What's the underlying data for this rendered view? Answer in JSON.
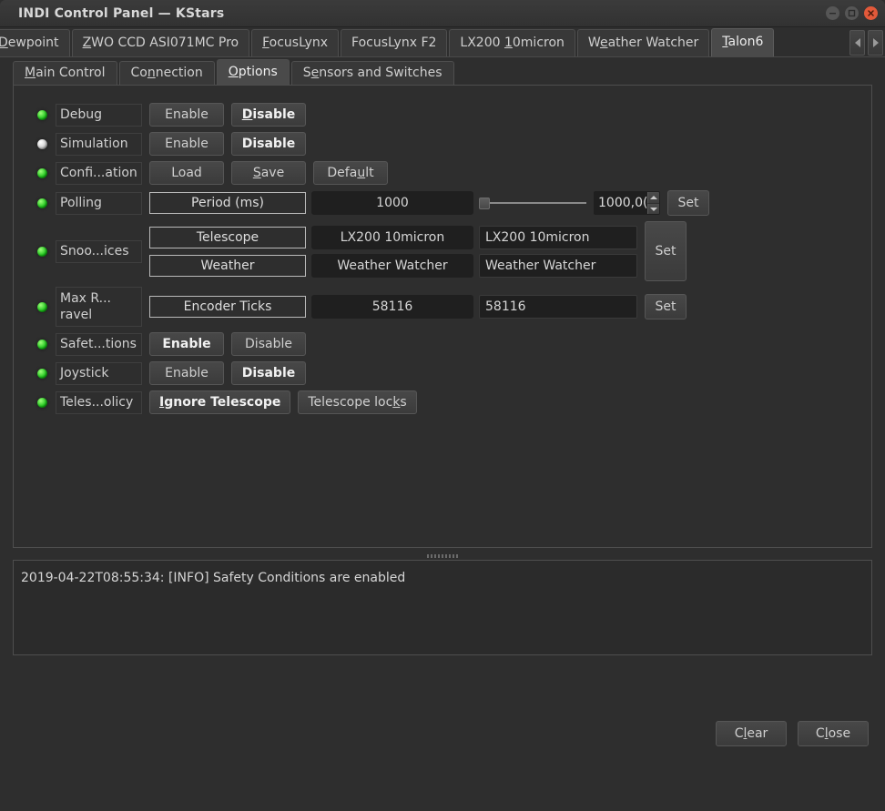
{
  "window": {
    "title": "INDI Control Panel — KStars",
    "controls": [
      {
        "name": "minimize",
        "glyph": "–"
      },
      {
        "name": "maximize",
        "glyph": "□"
      },
      {
        "name": "close",
        "glyph": "×"
      }
    ]
  },
  "device_tabs": [
    {
      "label": "Dewpoint",
      "prefix": "\u0003",
      "acc": "D",
      "active": false,
      "clipped": true
    },
    {
      "label": "ZWO CCD ASI071MC Pro",
      "acc": "Z",
      "active": false
    },
    {
      "label": "FocusLynx",
      "acc": "F",
      "active": false
    },
    {
      "label": "FocusLynx F2",
      "acc": "",
      "active": false
    },
    {
      "label": "LX200 10micron",
      "acc": "1",
      "active": false
    },
    {
      "label": "Weather Watcher",
      "acc": "W",
      "active": false
    },
    {
      "label": "Talon6",
      "acc": "T",
      "active": true
    }
  ],
  "tab_scroll": {
    "left": "scroll-left",
    "right": "scroll-right"
  },
  "sub_tabs": [
    {
      "label": "Main Control",
      "acc": "M",
      "active": false
    },
    {
      "label": "Connection",
      "acc": "n",
      "active": false
    },
    {
      "label": "Options",
      "acc": "O",
      "active": true
    },
    {
      "label": "Sensors and Switches",
      "acc": "e",
      "active": false
    }
  ],
  "properties": [
    {
      "name": "debug",
      "label": "Debug",
      "led": "ok",
      "type": "switch",
      "buttons": [
        {
          "label": "Enable",
          "state": "off",
          "acc": ""
        },
        {
          "label": "Disable",
          "state": "on",
          "acc": "D"
        }
      ]
    },
    {
      "name": "simulation",
      "label": "Simulation",
      "led": "idle",
      "type": "switch",
      "buttons": [
        {
          "label": "Enable",
          "state": "off",
          "acc": ""
        },
        {
          "label": "Disable",
          "state": "on",
          "acc": ""
        }
      ]
    },
    {
      "name": "configuration",
      "label": "Confi...ation",
      "led": "ok",
      "type": "switch",
      "buttons": [
        {
          "label": "Load",
          "state": "off",
          "acc": ""
        },
        {
          "label": "Save",
          "state": "off",
          "acc": "S"
        },
        {
          "label": "Default",
          "state": "off",
          "acc": "u"
        }
      ]
    },
    {
      "name": "polling",
      "label": "Polling",
      "led": "ok",
      "type": "number-slider",
      "field_name": "Period (ms)",
      "value": "1000",
      "spin_value": "1000,0(",
      "slider_position": 0,
      "set_label": "Set"
    },
    {
      "name": "snoop-devices",
      "label": "Snoo...ices",
      "led": "ok",
      "type": "text-rows",
      "set_label": "Set",
      "rows": [
        {
          "field_name": "Telescope",
          "value": "LX200 10micron",
          "input": "LX200 10micron"
        },
        {
          "field_name": "Weather",
          "value": "Weather Watcher",
          "input": "Weather Watcher"
        }
      ]
    },
    {
      "name": "max-ravel-travel",
      "label_line1": "Max R...",
      "label_line2": "ravel",
      "led": "ok",
      "type": "number-rows",
      "set_label": "Set",
      "rows": [
        {
          "field_name": "Encoder Ticks",
          "value": "58116",
          "input": "58116"
        }
      ]
    },
    {
      "name": "safety-conditions",
      "label": "Safet...tions",
      "led": "ok",
      "type": "switch",
      "buttons": [
        {
          "label": "Enable",
          "state": "on",
          "acc": ""
        },
        {
          "label": "Disable",
          "state": "off",
          "acc": ""
        }
      ]
    },
    {
      "name": "joystick",
      "label": "Joystick",
      "led": "ok",
      "type": "switch",
      "buttons": [
        {
          "label": "Enable",
          "state": "off",
          "acc": ""
        },
        {
          "label": "Disable",
          "state": "on",
          "acc": ""
        }
      ]
    },
    {
      "name": "telescope-policy",
      "label": "Teles...olicy",
      "led": "ok",
      "type": "switch",
      "buttons": [
        {
          "label": "Ignore Telescope",
          "state": "on",
          "acc": "I"
        },
        {
          "label": "Telescope locks",
          "state": "off",
          "acc": "k"
        }
      ]
    }
  ],
  "log": {
    "lines": [
      "2019-04-22T08:55:34: [INFO] Safety Conditions are enabled"
    ]
  },
  "footer": {
    "clear_label": "Clear",
    "clear_acc": "l",
    "close_label": "Close",
    "close_acc": "l"
  },
  "colors": {
    "window_bg": "#2e2e2e",
    "titlebar": "#383838",
    "close_button": "#e2593a",
    "led_ok": "#17c117",
    "led_idle": "#cfcfcf",
    "value_bg": "#1f1f1f",
    "text": "#d0d0d0"
  }
}
